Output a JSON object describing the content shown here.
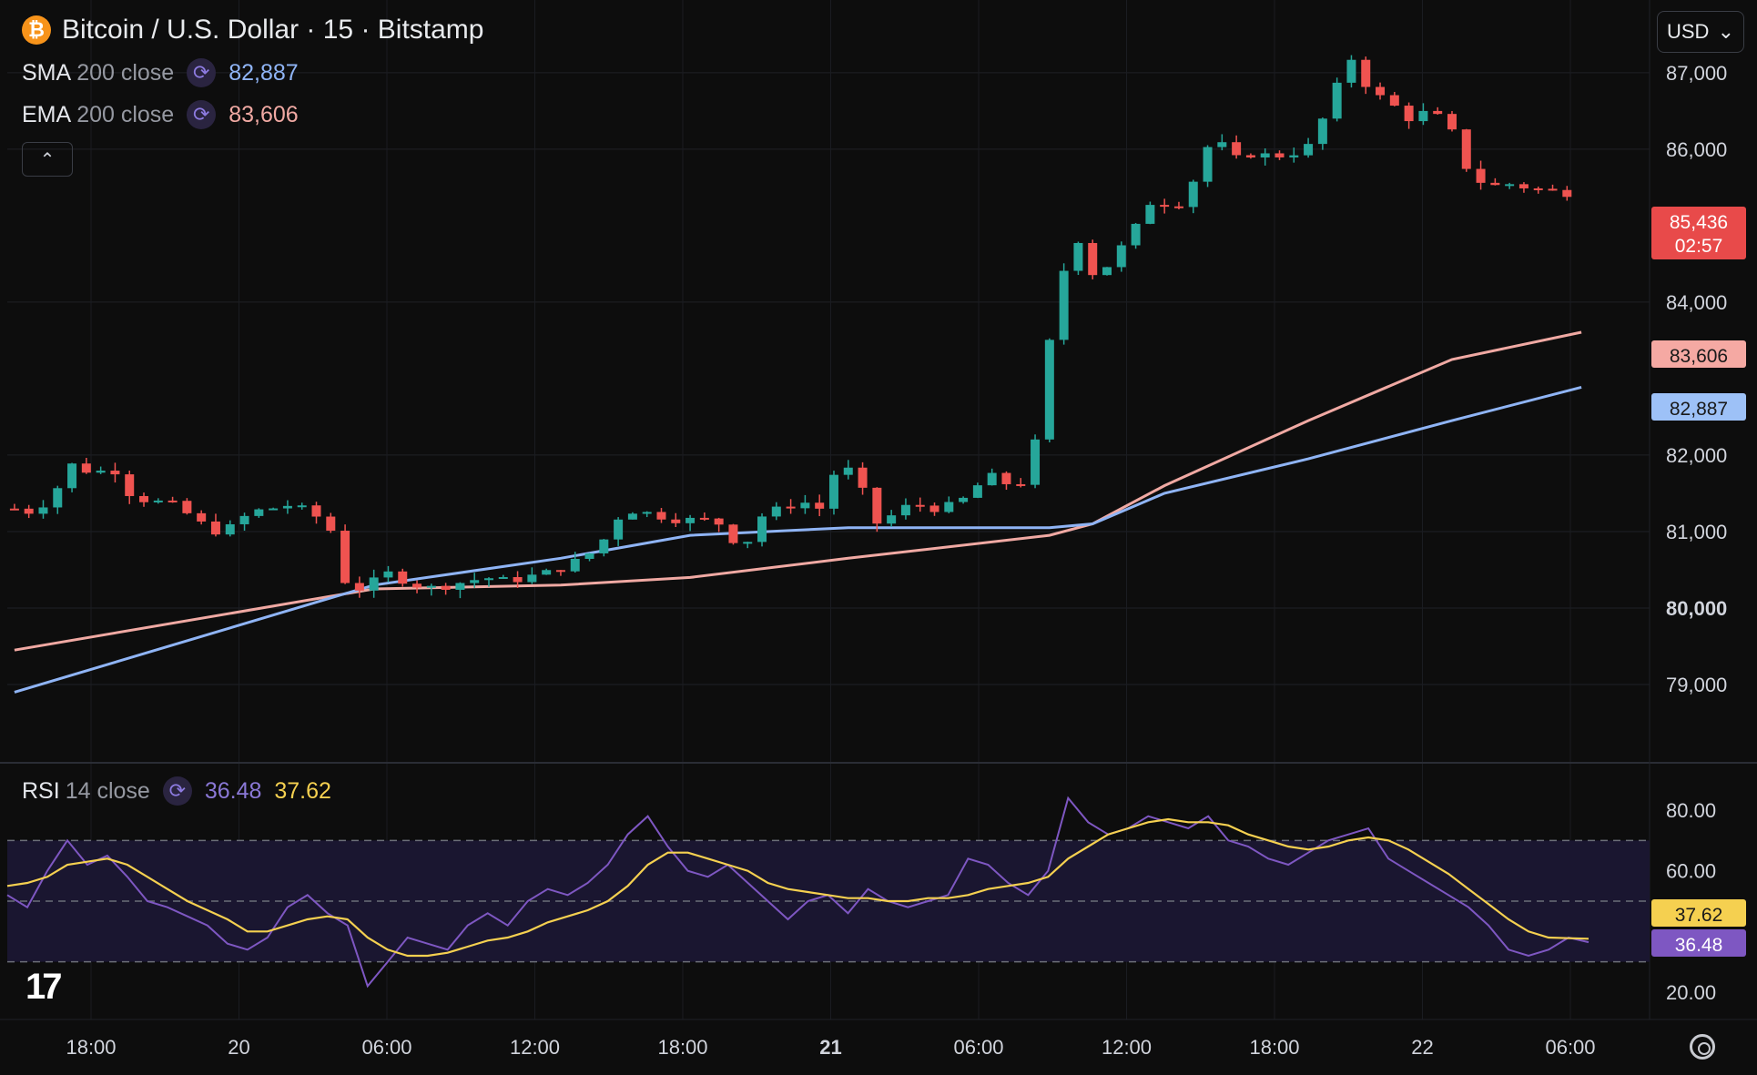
{
  "header": {
    "coin_glyph": "₿",
    "title": "Bitcoin / U.S. Dollar · 15 · Bitstamp",
    "currency": "USD"
  },
  "legend": {
    "sma": {
      "label": "SMA",
      "params": "200 close",
      "value": "82,887",
      "color": "#8fb4f5"
    },
    "ema": {
      "label": "EMA",
      "params": "200 close",
      "value": "83,606",
      "color": "#f0a9a3"
    },
    "rsi": {
      "label": "RSI",
      "params": "14 close",
      "value": "36.48",
      "ma_value": "37.62",
      "color": "#7e57c2",
      "ma_color": "#f5d050"
    }
  },
  "price_badges": {
    "last": "85,436",
    "countdown": "02:57",
    "ema": "83,606",
    "sma": "82,887",
    "rsi_ma": "37.62",
    "rsi": "36.48"
  },
  "logo": "17",
  "chart_data": {
    "type": "candlestick",
    "symbol": "BTCUSD",
    "interval": "15",
    "exchange": "Bitstamp",
    "x_ticks": [
      "18:00",
      "20",
      "06:00",
      "12:00",
      "18:00",
      "21",
      "06:00",
      "12:00",
      "18:00",
      "22",
      "06:00"
    ],
    "x_ticks_bold": [
      "21"
    ],
    "price_ticks": [
      79000,
      80000,
      81000,
      82000,
      84000,
      86000,
      87000
    ],
    "price_tick_labels": [
      "79,000",
      "80,000",
      "81,000",
      "82,000",
      "84,000",
      "86,000",
      "87,000"
    ],
    "ylim": [
      78000,
      87950
    ],
    "close_path": [
      81300,
      81250,
      81500,
      81900,
      81750,
      81850,
      81450,
      81400,
      81350,
      81200,
      81000,
      81050,
      81250,
      81300,
      81350,
      81250,
      81100,
      80200,
      80300,
      80450,
      80350,
      80250,
      80300,
      80350,
      80400,
      80350,
      80400,
      80450,
      80550,
      80650,
      80900,
      81300,
      81250,
      81200,
      81150,
      81150,
      81100,
      80750,
      81200,
      81300,
      81400,
      81300,
      81950,
      81600,
      81050,
      81300,
      81350,
      81300,
      81350,
      81600,
      81750,
      81500,
      82200,
      84100,
      84900,
      84300,
      84600,
      84950,
      85400,
      85200,
      85600,
      86200,
      85850,
      85950,
      85900,
      85950,
      86050,
      86650,
      87200,
      86750,
      86600,
      86400,
      86500,
      86300,
      85700,
      85500,
      85550,
      85500,
      85450,
      85436
    ],
    "sma200": {
      "x": [
        0,
        25,
        38,
        47,
        58,
        72,
        75,
        80,
        90,
        100,
        109
      ],
      "y": [
        78900,
        80300,
        80650,
        80950,
        81050,
        81050,
        81100,
        81500,
        81950,
        82450,
        82887
      ]
    },
    "ema200": {
      "x": [
        0,
        25,
        38,
        47,
        58,
        72,
        75,
        80,
        90,
        100,
        109
      ],
      "y": [
        79450,
        80250,
        80300,
        80400,
        80650,
        80950,
        81100,
        81600,
        82450,
        83250,
        83606
      ]
    },
    "rsi_ticks": [
      20,
      40,
      60,
      80
    ],
    "rsi_tick_labels": [
      "20.00",
      "",
      "60.00",
      "80.00"
    ],
    "rsi_band": [
      30,
      70
    ],
    "rsi_mid": 50,
    "rsi_series": [
      52,
      48,
      60,
      70,
      62,
      65,
      58,
      50,
      48,
      45,
      42,
      36,
      34,
      38,
      48,
      52,
      46,
      42,
      22,
      30,
      38,
      36,
      34,
      42,
      46,
      42,
      50,
      54,
      52,
      56,
      62,
      72,
      78,
      68,
      60,
      58,
      62,
      56,
      50,
      44,
      50,
      52,
      46,
      54,
      50,
      48,
      50,
      52,
      64,
      62,
      56,
      52,
      60,
      84,
      76,
      72,
      74,
      78,
      76,
      74,
      78,
      70,
      68,
      64,
      62,
      66,
      70,
      72,
      74,
      64,
      60,
      56,
      52,
      48,
      42,
      34,
      32,
      34,
      38,
      36.48
    ],
    "rsi_ma_series": [
      55,
      56,
      58,
      62,
      63,
      64,
      62,
      58,
      54,
      50,
      47,
      44,
      40,
      40,
      42,
      44,
      45,
      44,
      38,
      34,
      32,
      32,
      33,
      35,
      37,
      38,
      40,
      43,
      45,
      47,
      50,
      55,
      62,
      66,
      66,
      64,
      62,
      60,
      56,
      54,
      53,
      52,
      51,
      51,
      50,
      50,
      51,
      51,
      52,
      54,
      55,
      56,
      58,
      64,
      68,
      72,
      74,
      76,
      77,
      76,
      76,
      75,
      72,
      70,
      68,
      67,
      68,
      70,
      71,
      70,
      67,
      63,
      59,
      54,
      49,
      44,
      40,
      38,
      37.8,
      37.62
    ]
  }
}
